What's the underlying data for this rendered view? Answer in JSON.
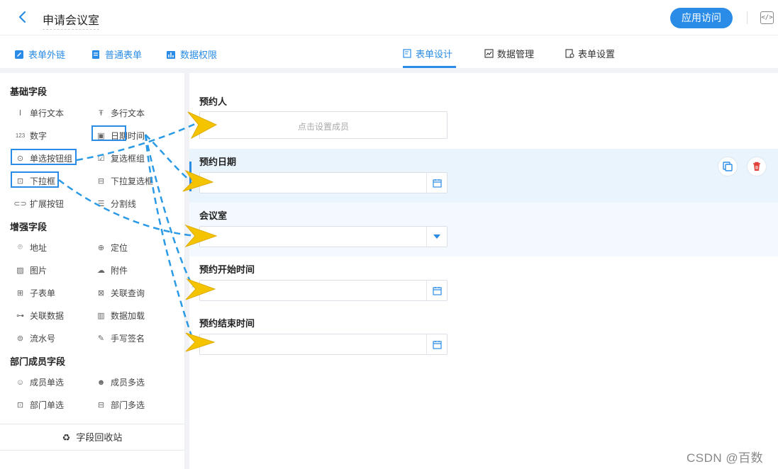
{
  "header": {
    "title": "申请会议室",
    "app_button": "应用访问",
    "back_icon": "chevron-left-icon",
    "code_icon": "code-icon",
    "accent": "#2a8ce6"
  },
  "subnav": {
    "links": [
      "表单外链",
      "普通表单",
      "数据权限"
    ],
    "tabs": [
      "表单设计",
      "数据管理",
      "表单设置"
    ],
    "active_tab": "表单设计"
  },
  "sidebar": {
    "sections": {
      "basic": "基础字段",
      "enhanced": "增强字段",
      "members": "部门成员字段"
    },
    "basic_fields": [
      "单行文本",
      "多行文本",
      "数字",
      "日期时间",
      "单选按钮组",
      "复选框组",
      "下拉框",
      "下拉复选框",
      "扩展按钮",
      "分割线"
    ],
    "enhanced_fields": [
      "地址",
      "定位",
      "图片",
      "附件",
      "子表单",
      "关联查询",
      "关联数据",
      "数据加载",
      "流水号",
      "手写签名"
    ],
    "member_fields": [
      "成员单选",
      "成员多选",
      "部门单选",
      "部门多选"
    ],
    "recycle": "字段回收站"
  },
  "form": {
    "fields": [
      {
        "label": "预约人",
        "placeholder": "点击设置成员",
        "kind": "member"
      },
      {
        "label": "预约日期",
        "kind": "date",
        "selected": true
      },
      {
        "label": "会议室",
        "kind": "select"
      },
      {
        "label": "预约开始时间",
        "kind": "date"
      },
      {
        "label": "预约结束时间",
        "kind": "date"
      }
    ],
    "copy_icon": "copy-icon",
    "delete_icon": "trash-icon",
    "delete_color": "#e2413a"
  },
  "watermark": "CSDN @百数"
}
